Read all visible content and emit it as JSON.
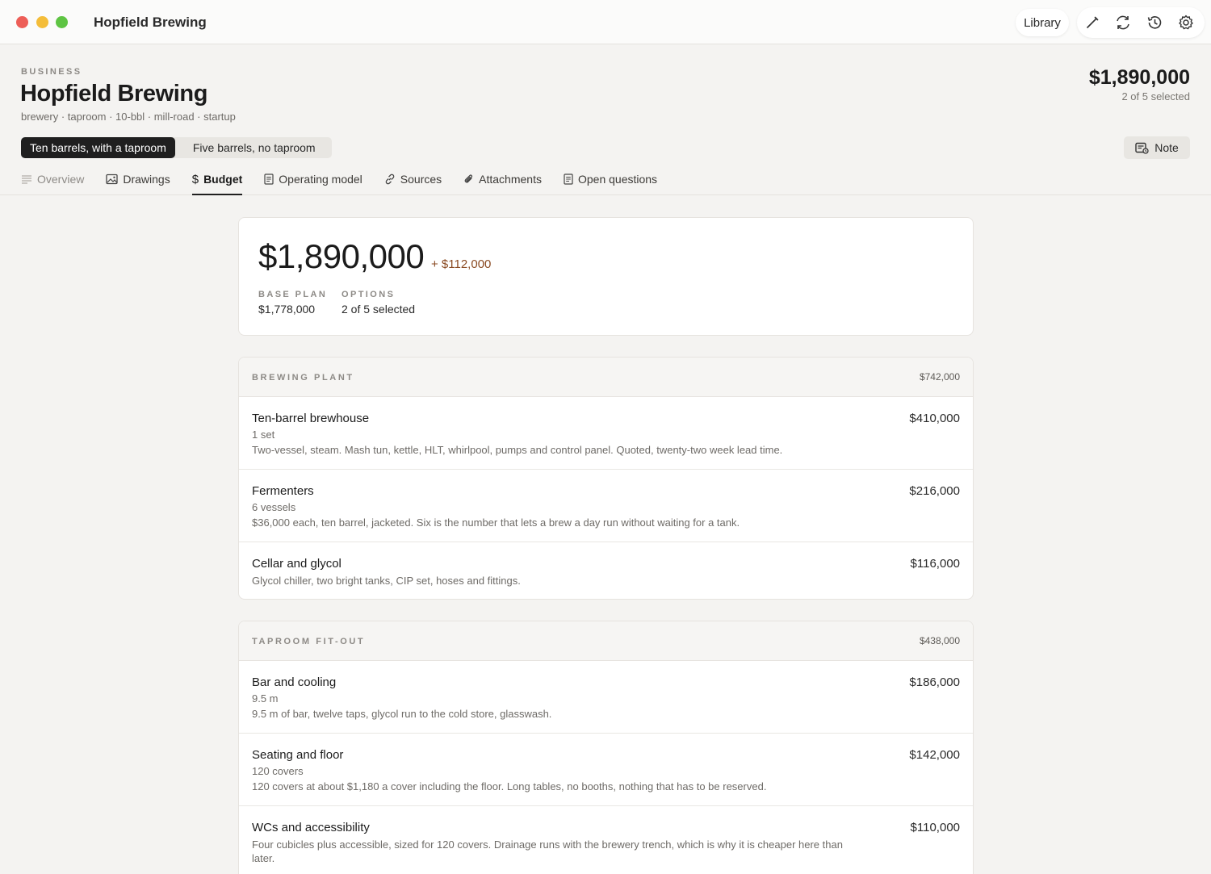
{
  "window": {
    "title": "Hopfield Brewing",
    "library_label": "Library",
    "tools": [
      "pencil-icon",
      "sync-icon",
      "history-icon",
      "gear-icon"
    ]
  },
  "header": {
    "eyebrow": "BUSINESS",
    "name": "Hopfield Brewing",
    "tags": "brewery · taproom · 10-bbl · mill-road · startup",
    "total": "$1,890,000",
    "selected": "2 of 5 selected"
  },
  "scenarios": {
    "active": "Ten barrels, with a taproom",
    "other": "Five barrels, no taproom"
  },
  "note_label": "Note",
  "tabs": [
    {
      "label": "Overview",
      "icon": "lines-icon"
    },
    {
      "label": "Drawings",
      "icon": "image-icon"
    },
    {
      "label": "Budget",
      "icon": "dollar-icon"
    },
    {
      "label": "Operating model",
      "icon": "doc-icon"
    },
    {
      "label": "Sources",
      "icon": "link-icon"
    },
    {
      "label": "Attachments",
      "icon": "paperclip-icon"
    },
    {
      "label": "Open questions",
      "icon": "doc-icon"
    }
  ],
  "summary": {
    "total": "$1,890,000",
    "delta": "+ $112,000",
    "base_label": "BASE PLAN",
    "base_value": "$1,778,000",
    "options_label": "OPTIONS",
    "options_value": "2 of 5 selected"
  },
  "sections": [
    {
      "title": "BREWING PLANT",
      "total": "$742,000",
      "items": [
        {
          "name": "Ten-barrel brewhouse",
          "qty": "1 set",
          "desc": "Two-vessel, steam. Mash tun, kettle, HLT, whirlpool, pumps and control panel. Quoted, twenty-two week lead time.",
          "amount": "$410,000"
        },
        {
          "name": "Fermenters",
          "qty": "6 vessels",
          "desc": "$36,000 each, ten barrel, jacketed. Six is the number that lets a brew a day run without waiting for a tank.",
          "amount": "$216,000"
        },
        {
          "name": "Cellar and glycol",
          "qty": "",
          "desc": "Glycol chiller, two bright tanks, CIP set, hoses and fittings.",
          "amount": "$116,000"
        }
      ]
    },
    {
      "title": "TAPROOM FIT-OUT",
      "total": "$438,000",
      "items": [
        {
          "name": "Bar and cooling",
          "qty": "9.5 m",
          "desc": "9.5 m of bar, twelve taps, glycol run to the cold store, glasswash.",
          "amount": "$186,000"
        },
        {
          "name": "Seating and floor",
          "qty": "120 covers",
          "desc": "120 covers at about $1,180 a cover including the floor. Long tables, no booths, nothing that has to be reserved.",
          "amount": "$142,000"
        },
        {
          "name": "WCs and accessibility",
          "qty": "",
          "desc": "Four cubicles plus accessible, sized for 120 covers. Drainage runs with the brewery trench, which is why it is cheaper here than later.",
          "amount": "$110,000"
        }
      ]
    }
  ]
}
